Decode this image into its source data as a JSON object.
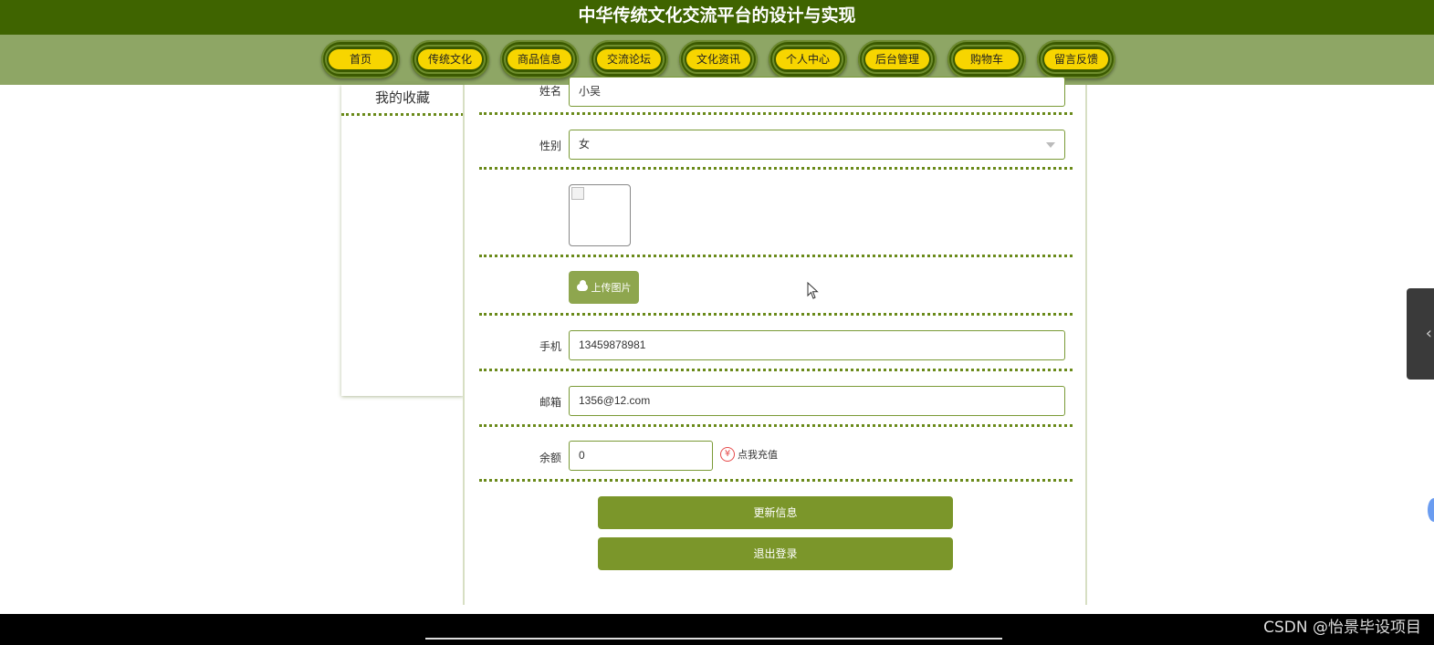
{
  "header": {
    "title": "中华传统文化交流平台的设计与实现"
  },
  "nav": {
    "items": [
      {
        "label": "首页"
      },
      {
        "label": "传统文化"
      },
      {
        "label": "商品信息"
      },
      {
        "label": "交流论坛"
      },
      {
        "label": "文化资讯"
      },
      {
        "label": "个人中心"
      },
      {
        "label": "后台管理"
      },
      {
        "label": "购物车"
      },
      {
        "label": "留言反馈"
      }
    ],
    "pill_color": "#f7d500"
  },
  "sidebar": {
    "items": [
      {
        "label": "我的收藏"
      }
    ]
  },
  "form": {
    "name": {
      "label": "姓名",
      "value": "小吴"
    },
    "gender": {
      "label": "性别",
      "value": "女"
    },
    "upload": {
      "label": "上传图片",
      "icon": "cloud-upload-icon"
    },
    "phone": {
      "label": "手机",
      "value": "13459878981"
    },
    "email": {
      "label": "邮箱",
      "value": "1356@12.com"
    },
    "balance": {
      "label": "余额",
      "value": "0",
      "recharge_label": "点我充值",
      "recharge_icon": "yen",
      "recharge_icon_glyph": "¥"
    },
    "update_button": "更新信息",
    "logout_button": "退出登录"
  },
  "right_tab": {
    "glyph": "‹"
  },
  "watermark": "CSDN @怡景毕设项目",
  "colors": {
    "header_bg": "#3f6400",
    "nav_bg": "#8ea665",
    "accent": "#7b962a"
  }
}
